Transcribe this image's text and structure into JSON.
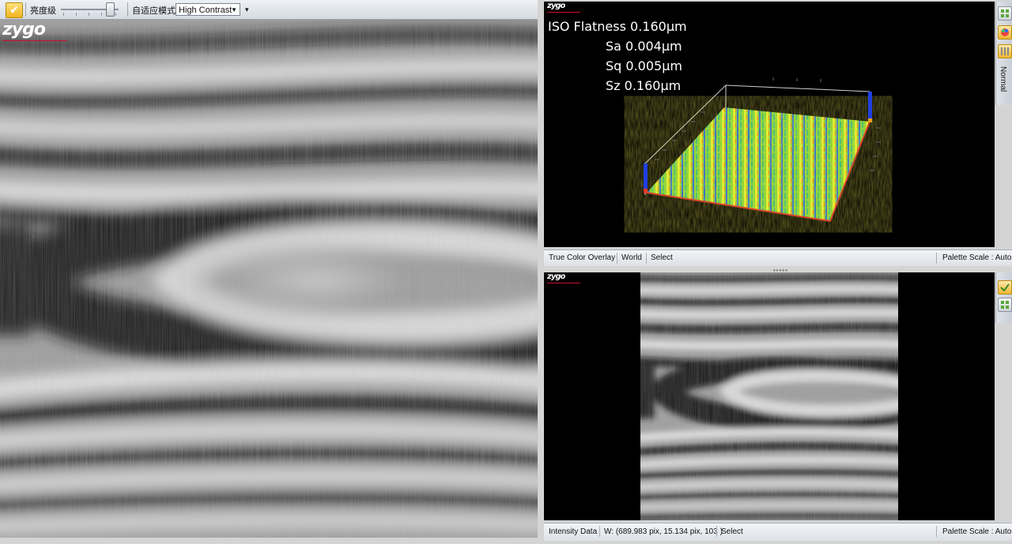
{
  "left_toolbar": {
    "brightness_label": "亮度级",
    "adaptive_mode_label": "自适应模式",
    "mode_value": "High Contrast"
  },
  "brand": {
    "logo_text": "zygo"
  },
  "surface_view": {
    "metrics": [
      {
        "text": "ISO Flatness 0.160µm"
      },
      {
        "text": "Sa 0.004µm"
      },
      {
        "text": "Sq 0.005µm"
      },
      {
        "text": "Sz 0.160µm"
      }
    ],
    "status": {
      "overlay": "True Color Overlay",
      "coords": "World",
      "tool": "Select",
      "palette": "Palette Scale : Auto"
    },
    "side_mode_label": "Normal"
  },
  "intensity_view": {
    "status": {
      "label": "Intensity Data",
      "readout": "W: (689.983 pix, 15.134 pix, 103 )",
      "tool": "Select",
      "palette": "Palette Scale : Auto"
    }
  },
  "colors": {
    "accent": "#c8102e",
    "check_button": "#f1b31c",
    "side_button_green": "#5aa83a"
  },
  "icons": [
    "check-icon",
    "dropdown-arrow-icon",
    "grid-icon",
    "palette-icon",
    "bars-icon",
    "checkmark-icon"
  ]
}
